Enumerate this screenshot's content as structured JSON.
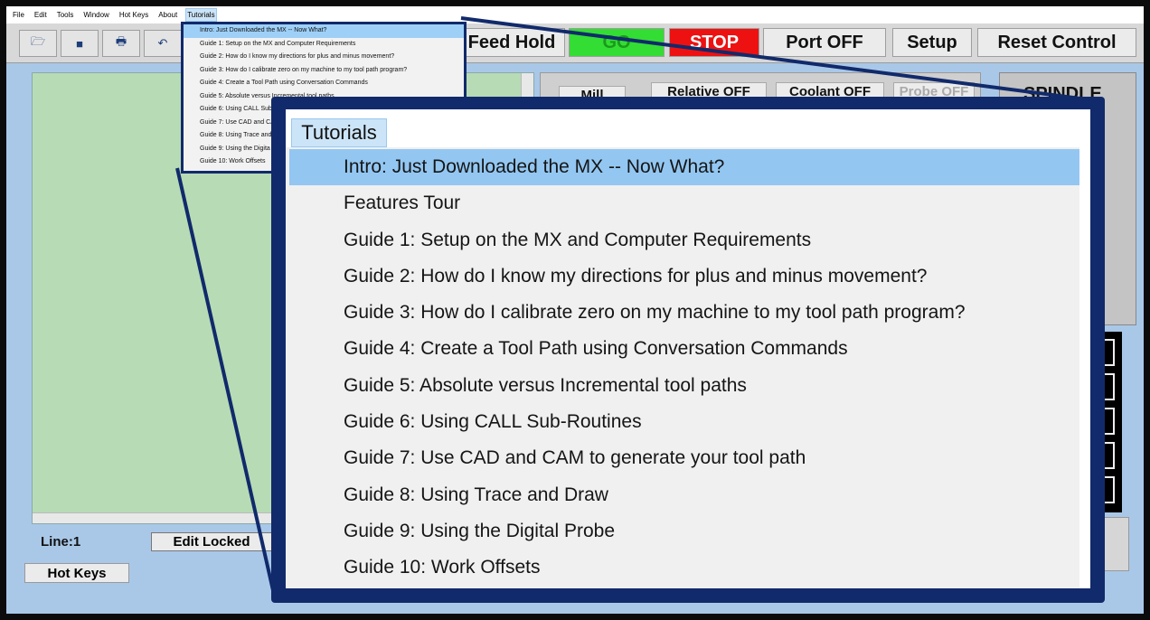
{
  "menubar": {
    "items": [
      "File",
      "Edit",
      "Tools",
      "Window",
      "Hot Keys",
      "About",
      "Tutorials"
    ],
    "active": "Tutorials"
  },
  "toolbar": {
    "icons": [
      "open-folder-icon",
      "save-icon",
      "print-icon",
      "undo-icon"
    ],
    "feed_hold": "Feed Hold",
    "go": "GO",
    "stop": "STOP",
    "port": "Port OFF",
    "setup": "Setup",
    "reset": "Reset Control"
  },
  "editor": {
    "line": "Line:1",
    "edit_locked": "Edit Locked"
  },
  "bottom": {
    "hot_keys": "Hot Keys"
  },
  "controls": {
    "mill": "Mill",
    "relative": "Relative OFF",
    "coolant": "Coolant OFF",
    "probe": "Probe OFF",
    "spindle": "SPINDLE"
  },
  "tutorials_menu": {
    "title": "Tutorials",
    "small_items": [
      "Intro: Just Downloaded the MX -- Now What?",
      "Guide 1: Setup on the MX and Computer Requirements",
      "Guide 2: How do I know my directions for plus and minus movement?",
      "Guide 3: How do I calibrate zero on my machine to my tool path program?",
      "Guide 4: Create a Tool Path using Conversation Commands",
      "Guide 5: Absolute versus Incremental tool paths",
      "Guide 6: Using CALL Sub",
      "Guide 7: Use CAD and CAI",
      "Guide 8: Using Trace and",
      "Guide 9: Using the Digita",
      "Guide 10: Work Offsets"
    ],
    "items": [
      "Intro: Just Downloaded the MX -- Now What?",
      "Features Tour",
      "Guide 1: Setup on the MX and Computer Requirements",
      "Guide 2: How do I know my directions for plus and minus movement?",
      "Guide 3: How do I calibrate zero on my machine to my tool path program?",
      "Guide 4: Create a Tool Path using Conversation Commands",
      "Guide 5: Absolute versus Incremental tool paths",
      "Guide 6: Using CALL Sub-Routines",
      "Guide 7: Use CAD and CAM to generate your tool path",
      "Guide 8: Using Trace and Draw",
      "Guide 9: Using the Digital Probe",
      "Guide 10: Work Offsets"
    ],
    "highlighted_index": 0
  },
  "colors": {
    "callout_border": "#112a6b",
    "highlight": "#93c7f2",
    "go": "#33dd33",
    "stop": "#ee1111"
  }
}
